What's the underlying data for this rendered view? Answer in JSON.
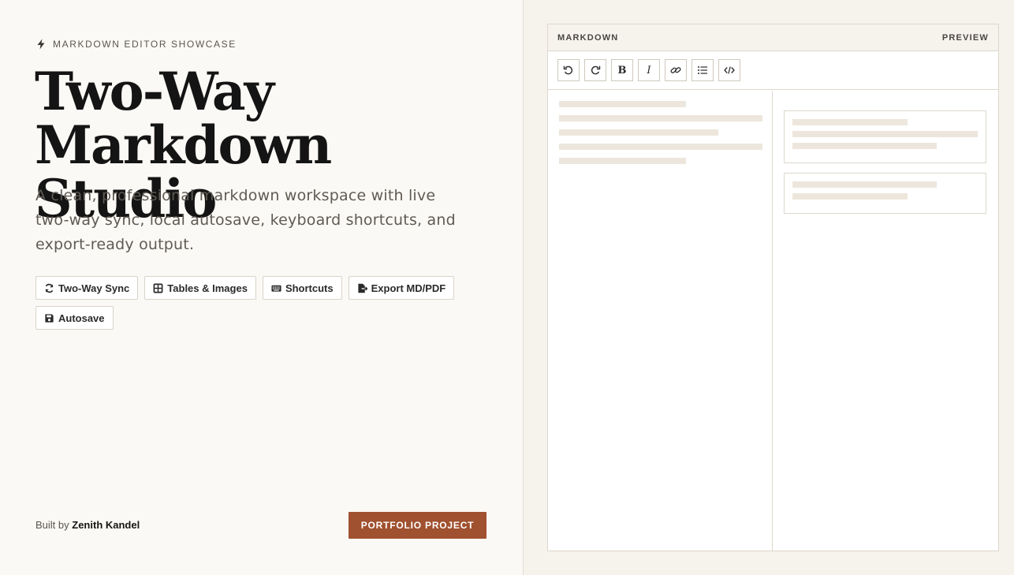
{
  "eyebrow": {
    "icon": "bolt-icon",
    "text": "MARKDOWN EDITOR SHOWCASE"
  },
  "hero": {
    "title_line1": "Two-Way",
    "title_line2": "Markdown Studio",
    "subtitle": "A clean, professional markdown workspace with live two-way sync, local autosave, keyboard shortcuts, and export-ready output."
  },
  "features": [
    {
      "icon": "sync-icon",
      "label": "Two-Way Sync"
    },
    {
      "icon": "table-icon",
      "label": "Tables & Images"
    },
    {
      "icon": "keyboard-icon",
      "label": "Shortcuts"
    },
    {
      "icon": "file-export-icon",
      "label": "Export MD/PDF"
    },
    {
      "icon": "save-icon",
      "label": "Autosave"
    }
  ],
  "footer": {
    "built_by_prefix": "Built by",
    "author": "Zenith Kandel",
    "cta_label": "PORTFOLIO PROJECT"
  },
  "editor": {
    "left_label": "MARKDOWN",
    "right_label": "PREVIEW",
    "toolbar": [
      {
        "name": "undo",
        "icon": "undo-icon"
      },
      {
        "name": "redo",
        "icon": "redo-icon"
      },
      {
        "name": "bold",
        "icon": "bold-icon",
        "glyph": "B"
      },
      {
        "name": "italic",
        "icon": "italic-icon",
        "glyph": "I"
      },
      {
        "name": "link",
        "icon": "link-icon"
      },
      {
        "name": "list",
        "icon": "list-icon"
      },
      {
        "name": "code",
        "icon": "code-icon"
      }
    ]
  },
  "colors": {
    "accent": "#a0512f",
    "page_bg": "#fbf9f5",
    "panel_bg": "#f6f3ed",
    "skeleton": "#ede6dc",
    "border": "#ddd7cd"
  }
}
